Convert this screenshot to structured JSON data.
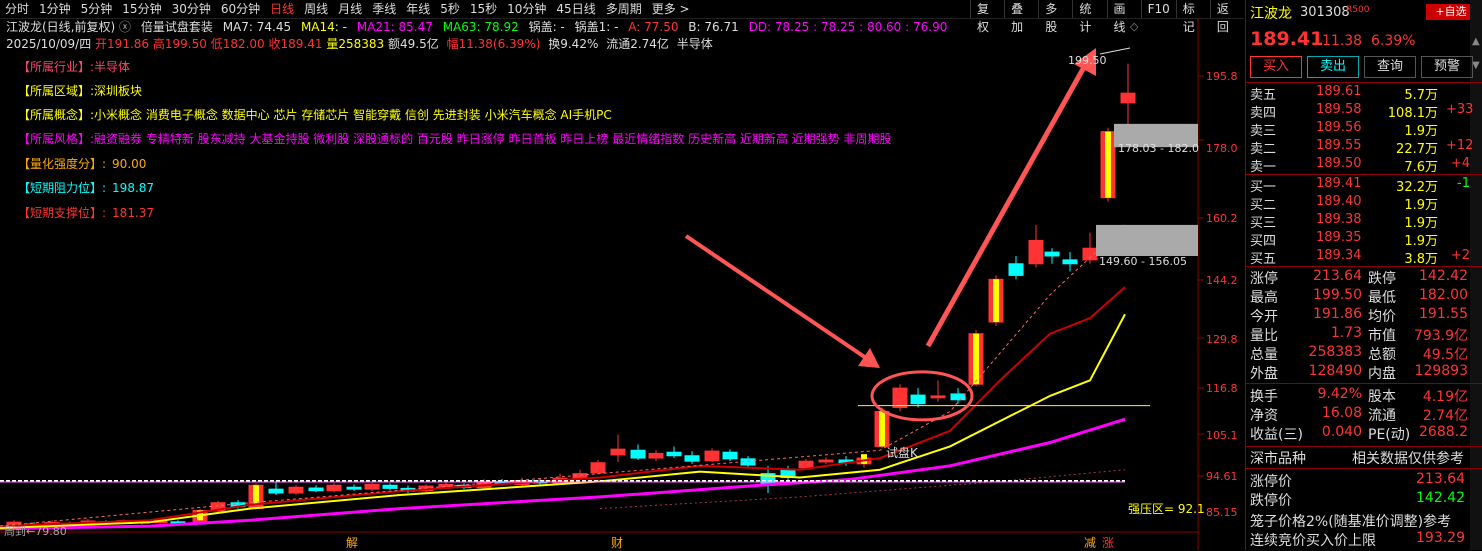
{
  "toolbar": {
    "periods": [
      "分时",
      "1分钟",
      "5分钟",
      "15分钟",
      "30分钟",
      "60分钟",
      "日线",
      "周线",
      "月线",
      "季线",
      "年线",
      "5秒",
      "15秒",
      "10分钟",
      "45日线",
      "多周期",
      "更多 >"
    ],
    "active_period": "日线",
    "tools": [
      "复权",
      "叠加",
      "多股",
      "统计",
      "画线",
      "F10",
      "标记",
      "返回"
    ]
  },
  "header": {
    "title": "江波龙(日线,前复权)",
    "indicator": "倍量试盘套装",
    "ma7": "MA7: 74.45",
    "ma14": "MA14: -",
    "ma21": "MA21: 85.47",
    "ma63": "MA63: 78.92",
    "guogai": "锅盖: -",
    "guogai1": "锅盖1: -",
    "a": "A: 77.50",
    "b": "B: 76.71",
    "dd": "DD: 78.25 : 78.25 : 80.60 : 76.90",
    "date": "2025/10/09/四",
    "open": "开191.86",
    "high": "高199.50",
    "low": "低182.00",
    "close": "收189.41",
    "vol": "量258383",
    "amount": "额49.5亿",
    "change": "幅11.38(6.39%)",
    "turnover": "换9.42%",
    "float": "流通2.74亿",
    "sector": "半导体"
  },
  "info": {
    "industry": {
      "label": "【所属行业】:",
      "value": "半导体"
    },
    "region": {
      "label": "【所属区域】:",
      "value": "深圳板块"
    },
    "concept": {
      "label": "【所属概念】:",
      "value": "小米概念 消费电子概念 数据中心 芯片 存储芯片 智能穿戴 信创 先进封装 小米汽车概念 AI手机PC"
    },
    "style": {
      "label": "【所属风格】:",
      "value": "融资融券 专精特新 股东减持 大基金持股 微利股 深股通标的 百元股 昨日涨停 昨日首板 昨日上榜 最近情绪指数 历史新高 近期新高 近期强势 非周期股"
    },
    "strength": {
      "label": "【量化强度分】:",
      "value": "90.00"
    },
    "resistance": {
      "label": "【短期阻力位】:",
      "value": "198.87"
    },
    "support": {
      "label": "【短期支撑位】:",
      "value": "181.37"
    }
  },
  "annotations": {
    "peak": "199.50",
    "zone_upper": "178.03 - 182.0",
    "zone_lower": "149.60 - 156.05",
    "test_k": "试盘K",
    "pressure": "强压区= 92.1",
    "low": "79.80",
    "low_prefix": "周到←",
    "bottom_marks": [
      "解",
      "财",
      "减",
      "涨"
    ]
  },
  "axis": {
    "ticks": [
      "195.8",
      "178.0",
      "160.2",
      "144.2",
      "129.8",
      "116.8",
      "105.1",
      "94.61",
      "85.15"
    ]
  },
  "quote": {
    "name": "江波龙",
    "code": "301308",
    "tag": "R500",
    "add_label": "+自选",
    "price": "189.41",
    "change": "11.38",
    "pct": "6.39%",
    "buttons": [
      "买入",
      "卖出",
      "查询",
      "预警"
    ],
    "asks": [
      {
        "label": "卖五",
        "price": "189.61",
        "vol": "5.7万",
        "delta": ""
      },
      {
        "label": "卖四",
        "price": "189.58",
        "vol": "108.1万",
        "delta": "+33"
      },
      {
        "label": "卖三",
        "price": "189.56",
        "vol": "1.9万",
        "delta": ""
      },
      {
        "label": "卖二",
        "price": "189.55",
        "vol": "22.7万",
        "delta": "+12"
      },
      {
        "label": "卖一",
        "price": "189.50",
        "vol": "7.6万",
        "delta": "+4"
      }
    ],
    "bids": [
      {
        "label": "买一",
        "price": "189.41",
        "vol": "32.2万",
        "delta": "-1"
      },
      {
        "label": "买二",
        "price": "189.40",
        "vol": "1.9万",
        "delta": ""
      },
      {
        "label": "买三",
        "price": "189.38",
        "vol": "1.9万",
        "delta": ""
      },
      {
        "label": "买四",
        "price": "189.35",
        "vol": "1.9万",
        "delta": ""
      },
      {
        "label": "买五",
        "price": "189.34",
        "vol": "3.8万",
        "delta": "+2"
      }
    ],
    "stats": [
      {
        "l1": "涨停",
        "v1": "213.64",
        "l2": "跌停",
        "v2": "142.42"
      },
      {
        "l1": "最高",
        "v1": "199.50",
        "l2": "最低",
        "v2": "182.00"
      },
      {
        "l1": "今开",
        "v1": "191.86",
        "l2": "均价",
        "v2": "191.55"
      },
      {
        "l1": "量比",
        "v1": "1.73",
        "l2": "市值",
        "v2": "793.9亿"
      },
      {
        "l1": "总量",
        "v1": "258383",
        "l2": "总额",
        "v2": "49.5亿"
      },
      {
        "l1": "外盘",
        "v1": "128490",
        "l2": "内盘",
        "v2": "129893"
      }
    ],
    "stats2": [
      {
        "l1": "换手",
        "v1": "9.42%",
        "l2": "股本",
        "v2": "4.19亿"
      },
      {
        "l1": "净资",
        "v1": "16.08",
        "l2": "流通",
        "v2": "2.74亿"
      },
      {
        "l1": "收益(三)",
        "v1": "0.040",
        "l2": "PE(动)",
        "v2": "2688.2"
      }
    ],
    "market_label": "深市品种",
    "market_note": "相关数据仅供参考",
    "limits": [
      {
        "label": "涨停价",
        "value": "213.64"
      },
      {
        "label": "跌停价",
        "value": "142.42"
      }
    ],
    "cage": "笼子价格2%(随基准价调整)参考",
    "auction": {
      "label": "连续竞价买入价上限",
      "value": "193.29"
    }
  },
  "colors": {
    "up": "#ff3333",
    "down": "#00ffff",
    "ma_yellow": "#ffff00",
    "ma_magenta": "#ff00ff",
    "ma_red": "#cc0000"
  }
}
